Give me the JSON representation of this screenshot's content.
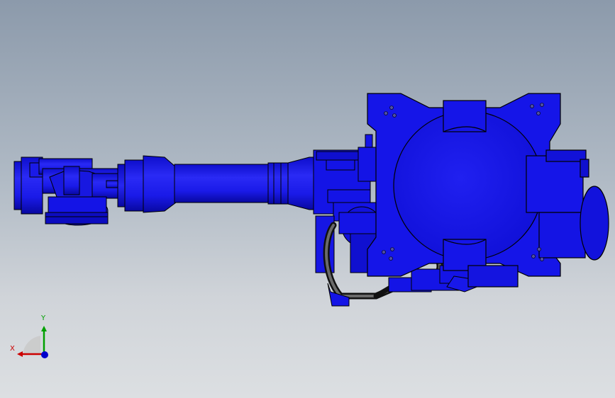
{
  "viewport": {
    "background_top": "#8c9aab",
    "background_bottom": "#dcdfe2"
  },
  "model": {
    "body_color": "#1414e6",
    "shade_color": "#0a0aa8",
    "edge_color": "#000000",
    "cable_color": "#2a2a2a"
  },
  "triad": {
    "x_label": "X",
    "y_label": "Y",
    "x_color": "#cc0000",
    "y_color": "#00a000",
    "z_color": "#0000cc"
  }
}
